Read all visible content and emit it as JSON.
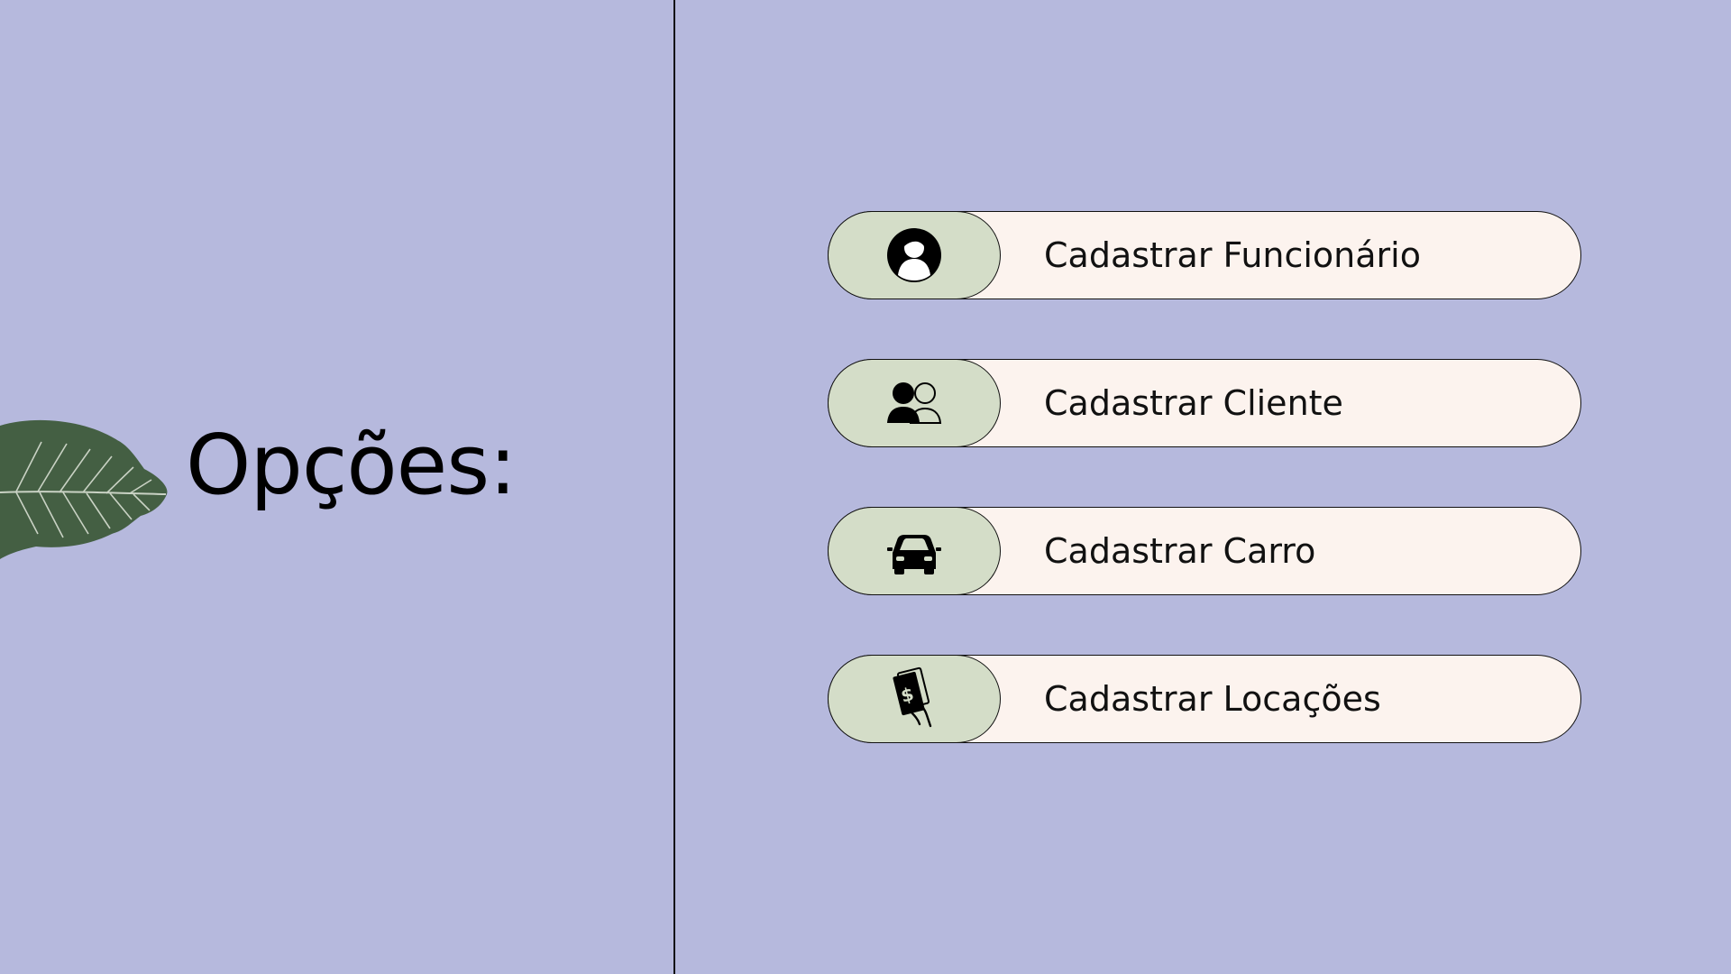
{
  "title": "Opções:",
  "colors": {
    "background": "#b6b9dd",
    "pill": "#fcf3ee",
    "icon_pill": "#d4ddc8",
    "leaf": "#445f43"
  },
  "options": [
    {
      "label": "Cadastrar Funcionário",
      "icon": "employee-avatar-icon"
    },
    {
      "label": "Cadastrar Cliente",
      "icon": "users-icon"
    },
    {
      "label": "Cadastrar Carro",
      "icon": "car-icon"
    },
    {
      "label": "Cadastrar Locações",
      "icon": "cash-in-hand-icon"
    }
  ]
}
